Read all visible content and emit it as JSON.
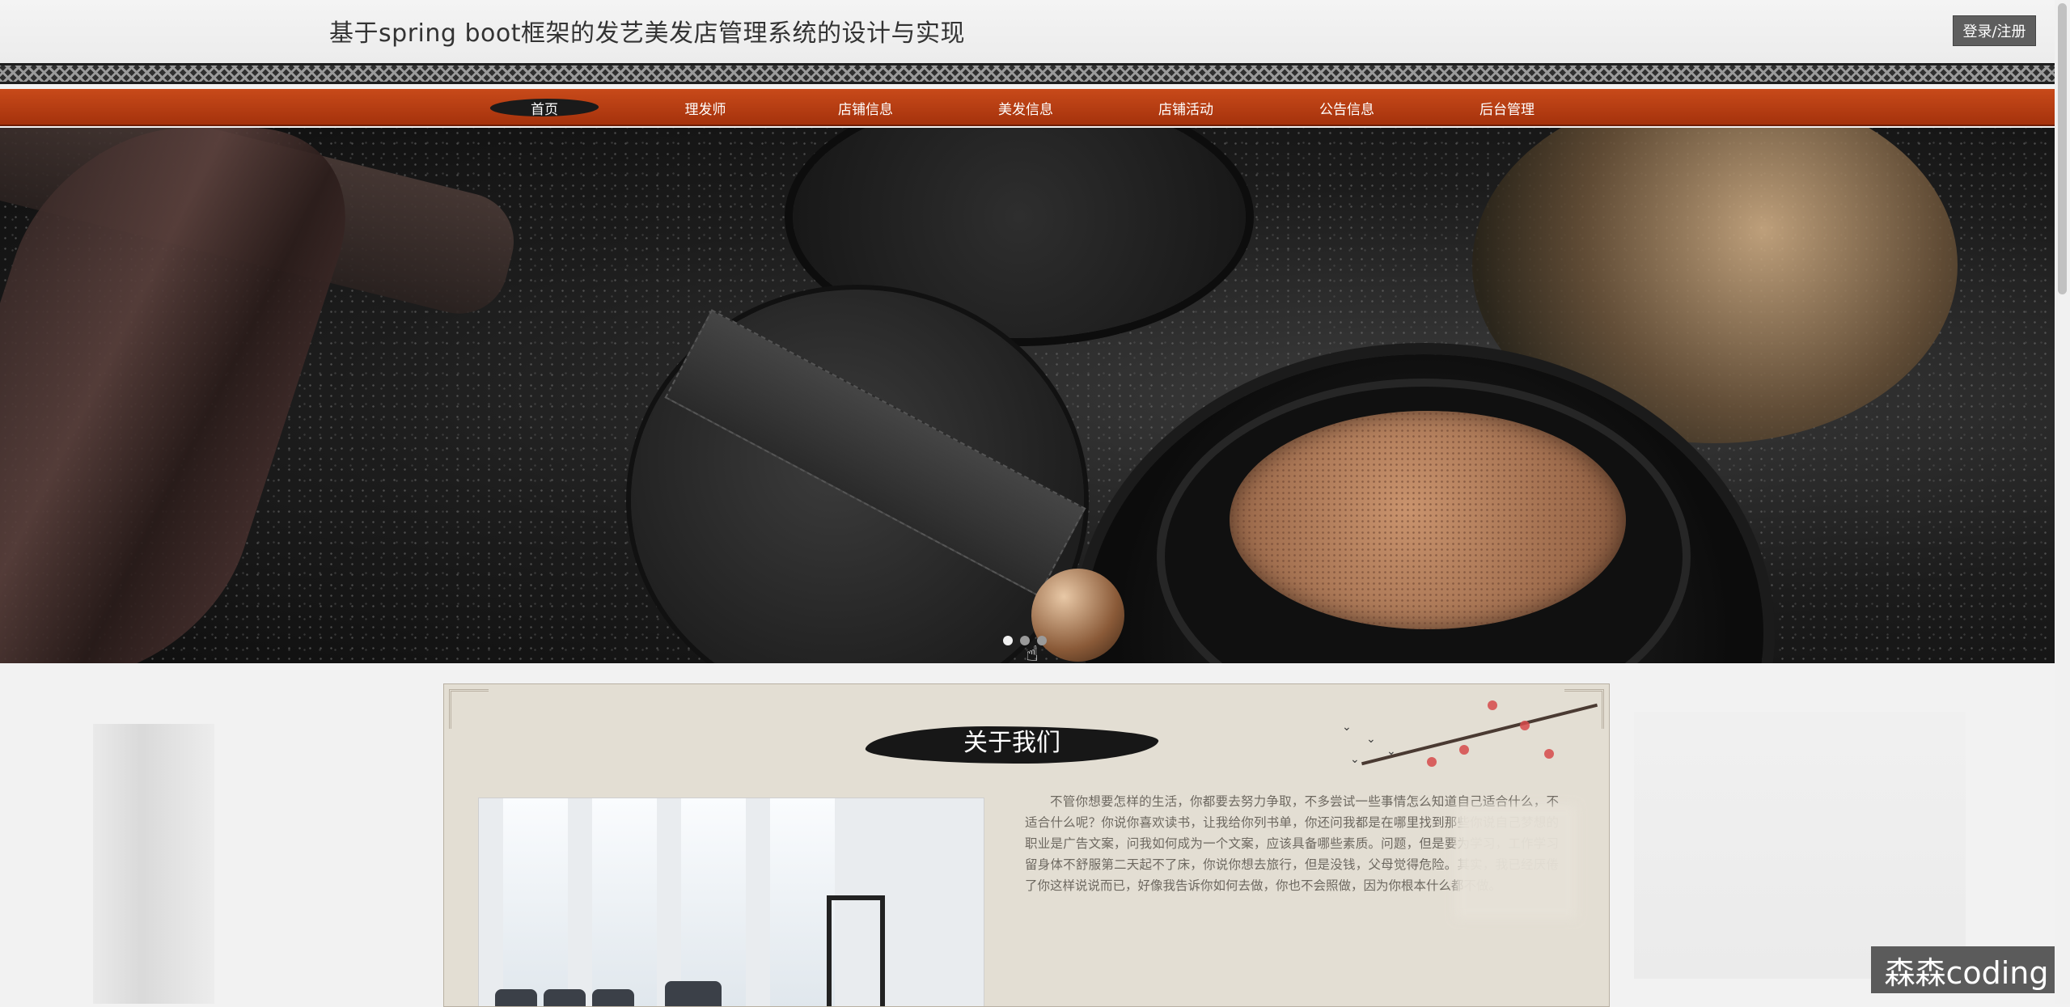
{
  "header": {
    "site_title": "基于spring boot框架的发艺美发店管理系统的设计与实现",
    "login_label": "登录/注册"
  },
  "nav": {
    "items": [
      {
        "label": "首页",
        "active": true
      },
      {
        "label": "理发师"
      },
      {
        "label": "店铺信息"
      },
      {
        "label": "美发信息"
      },
      {
        "label": "店铺活动"
      },
      {
        "label": "公告信息"
      },
      {
        "label": "后台管理"
      }
    ]
  },
  "banner": {
    "slide_count": 3,
    "active_slide": 1
  },
  "about": {
    "title": "关于我们",
    "text": "不管你想要怎样的生活，你都要去努力争取，不多尝试一些事情怎么知道自己适合什么，不适合什么呢？你说你喜欢读书，让我给你列书单，你还问我都是在哪里找到那些你说自己梦想的职业是广告文案，问我如何成为一个文案，应该具备哪些素质。问题，但是要为学习，工作学习留身体不舒服第二天起不了床，你说你想去旅行，但是没钱，父母觉得危险。其实，我已经厌倦了你这样说说而已，好像我告诉你如何去做，你也不会照做，因为你根本什么都不做。"
  },
  "watermark": {
    "text": "森森coding"
  },
  "colors": {
    "nav_bg": "#b33c12",
    "about_bg": "#e3ded3"
  }
}
